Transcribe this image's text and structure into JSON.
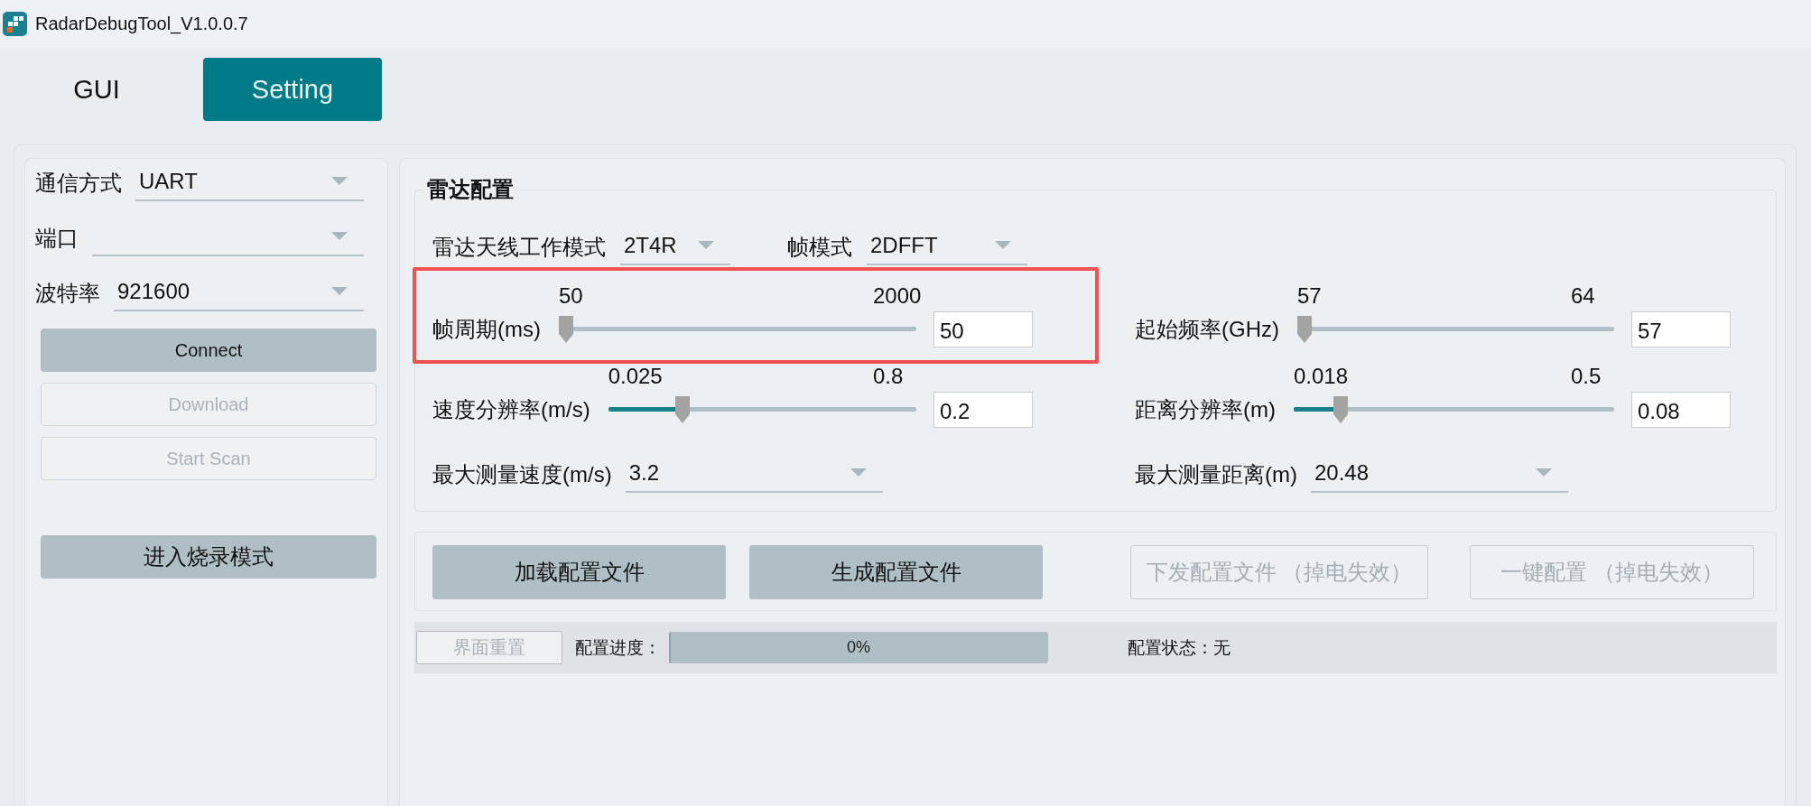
{
  "window": {
    "title": "RadarDebugTool_V1.0.0.7"
  },
  "tabs": [
    {
      "label": "GUI",
      "selected": false
    },
    {
      "label": "Setting",
      "selected": true
    }
  ],
  "connection_panel": {
    "fields": [
      {
        "label": "通信方式",
        "value": "UART"
      },
      {
        "label": "端口"
      },
      {
        "label": "波特率",
        "value": "921600"
      }
    ],
    "buttons": [
      {
        "label": "Connect",
        "disabled": false
      },
      {
        "label": "Download",
        "disabled": true
      },
      {
        "label": "Start Scan",
        "disabled": true
      }
    ],
    "burn_button": {
      "label": "进入烧录模式",
      "disabled": false
    }
  },
  "radar_config": {
    "title": "雷达配置",
    "mode_fields": [
      {
        "label": "雷达天线工作模式",
        "value": "2T4R"
      },
      {
        "label": "帧模式",
        "value": "2DFFT"
      }
    ],
    "columns": [
      {
        "items": [
          {
            "kind": "slider",
            "label": "帧周期(ms)",
            "min": "50",
            "max": "2000",
            "level": 0,
            "value": "50",
            "highlighted": true
          },
          {
            "kind": "slider",
            "label": "速度分辨率(m/s)",
            "min": "0.025",
            "max": "0.8",
            "level": 0.23,
            "value": "0.2",
            "highlighted": false
          },
          {
            "kind": "dropdown",
            "label": "最大测量速度(m/s)",
            "value": "3.2",
            "highlighted": false
          }
        ]
      },
      {
        "items": [
          {
            "kind": "slider",
            "label": "起始频率(GHz)",
            "min": "57",
            "max": "64",
            "level": 0,
            "value": "57",
            "highlighted": false
          },
          {
            "kind": "slider",
            "label": "距离分辨率(m)",
            "min": "0.018",
            "max": "0.5",
            "level": 0.13,
            "value": "0.08",
            "highlighted": false
          },
          {
            "kind": "dropdown",
            "label": "最大测量距离(m)",
            "value": "20.48",
            "highlighted": false
          }
        ]
      }
    ]
  },
  "file_buttons": [
    {
      "label": "加载配置文件",
      "disabled": false
    },
    {
      "label": "生成配置文件",
      "disabled": false
    },
    {
      "label": "下发配置文件 （掉电失效）",
      "disabled": true
    },
    {
      "label": "一键配置 （掉电失效）",
      "disabled": true
    }
  ],
  "status_bar": {
    "reset_button": {
      "label": "界面重置",
      "disabled": true
    },
    "progress_label": "配置进度：",
    "progress": {
      "level": 0,
      "text": "0%"
    },
    "status": "配置状态：无"
  }
}
